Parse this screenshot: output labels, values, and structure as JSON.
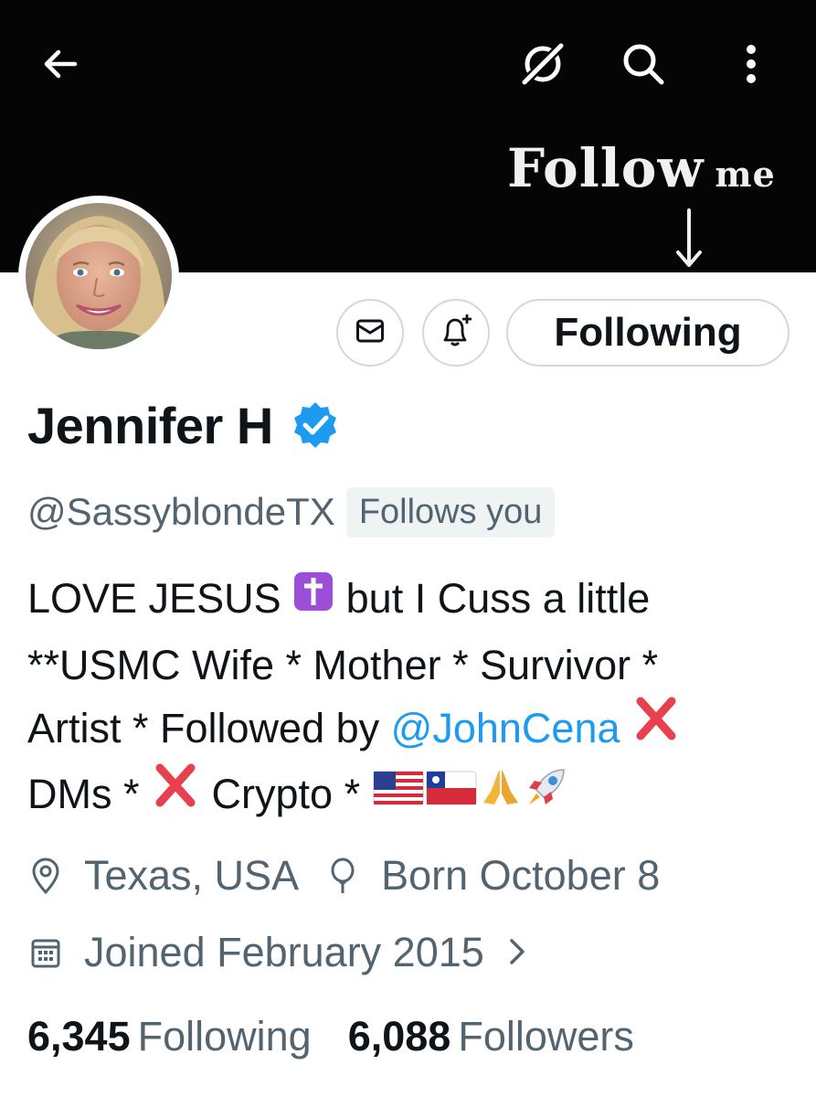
{
  "banner": {
    "text_main": "Follow",
    "text_small": "me",
    "background": "#050505"
  },
  "toolbar": {
    "back_icon": "arrow-left-icon",
    "grok_icon": "grok-icon",
    "search_icon": "search-icon",
    "more_icon": "more-vertical-icon"
  },
  "actions": {
    "message_icon": "envelope-icon",
    "notify_icon": "bell-plus-icon",
    "following_label": "Following"
  },
  "profile": {
    "name": "Jennifer H",
    "verified_icon": "verified-badge-icon",
    "handle": "@SassyblondeTX",
    "follows_you": "Follows you"
  },
  "bio": {
    "line1_a": "LOVE JESUS",
    "line1_b": "but I Cuss a little",
    "line2": "**USMC Wife * Mother * Survivor *",
    "line3_a": "Artist * Followed by",
    "mention": "@JohnCena",
    "line4_a": "DMs *",
    "line4_b": "Crypto *"
  },
  "meta": {
    "location": "Texas, USA",
    "birthday": "Born October 8",
    "joined": "Joined February 2015"
  },
  "counts": {
    "following_num": "6,345",
    "following_label": "Following",
    "followers_num": "6,088",
    "followers_label": "Followers"
  },
  "colors": {
    "accent": "#1d9bf0",
    "secondary_text": "#536471",
    "primary_text": "#0f1419",
    "border": "#cfd9de"
  }
}
